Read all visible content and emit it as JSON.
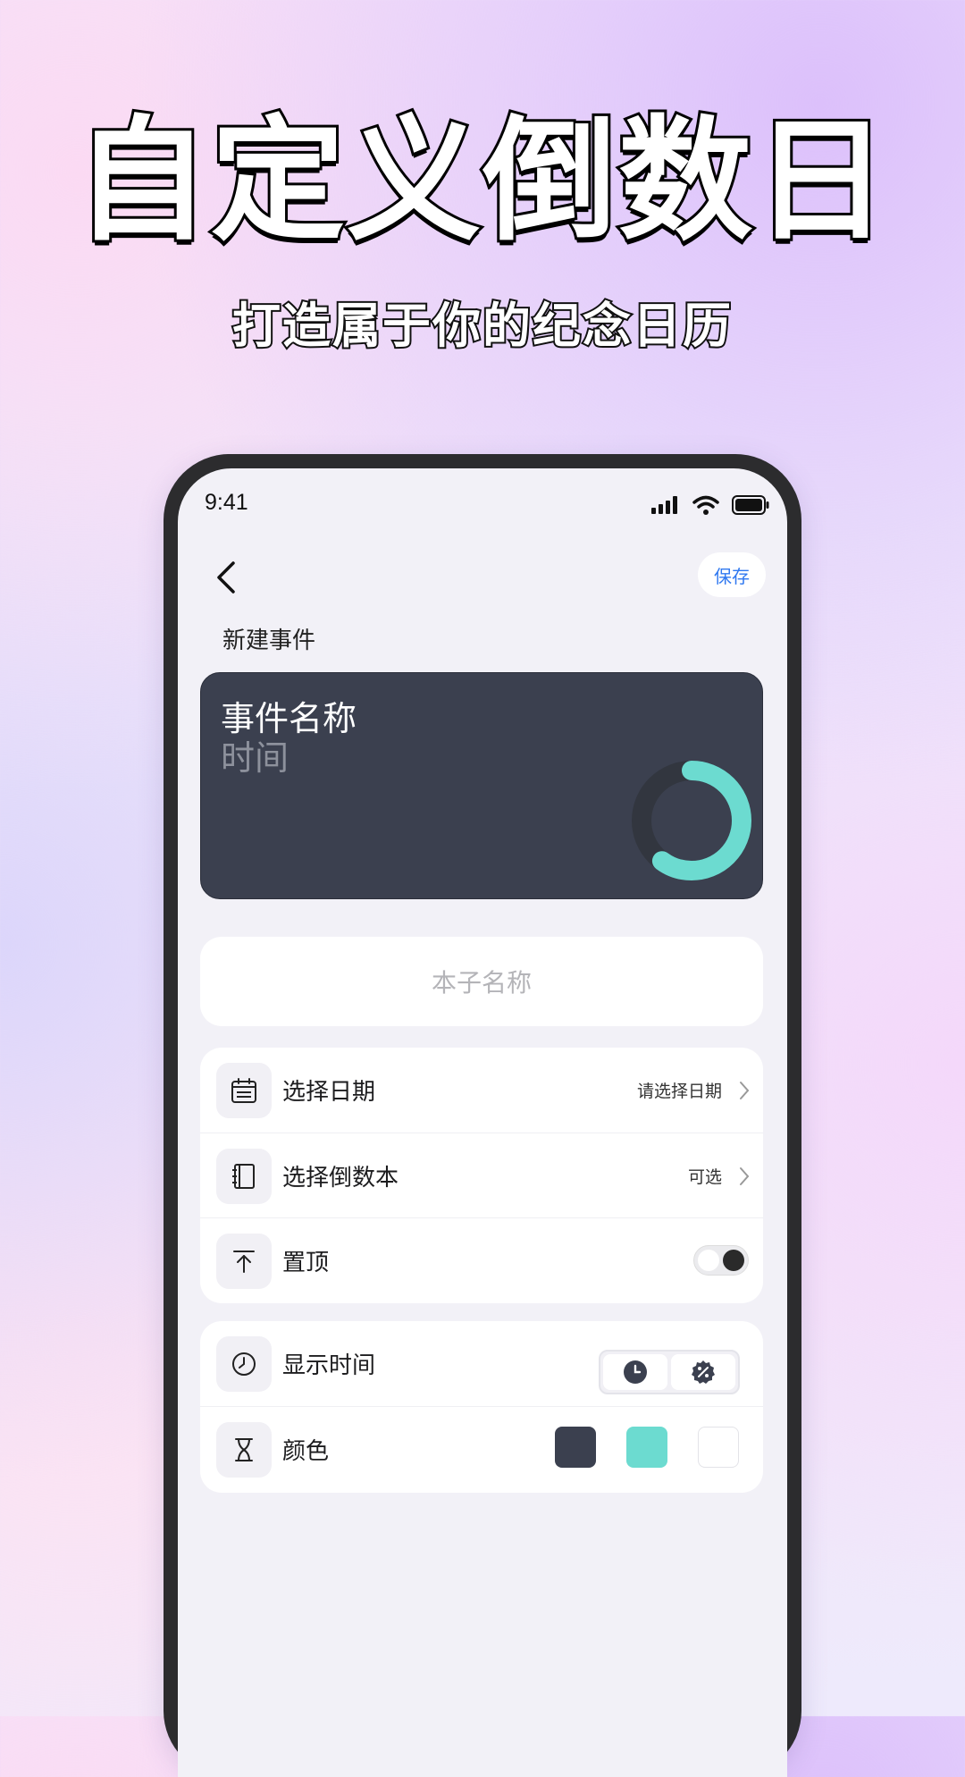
{
  "promo": {
    "headline": "自定义倒数日",
    "subheadline": "打造属于你的纪念日历"
  },
  "status_bar": {
    "time": "9:41"
  },
  "nav": {
    "save_label": "保存",
    "title": "新建事件"
  },
  "preview": {
    "event_name": "事件名称",
    "time_label": "时间",
    "ring_progress": 0.6,
    "colors": {
      "card": "#3b404f",
      "ring": "#6cdbd0"
    }
  },
  "notebook_field": {
    "placeholder": "本子名称"
  },
  "settings": {
    "date": {
      "label": "选择日期",
      "value": "请选择日期"
    },
    "notebook": {
      "label": "选择倒数本",
      "value": "可选"
    },
    "pin": {
      "label": "置顶"
    },
    "display_time": {
      "label": "显示时间"
    },
    "color": {
      "label": "颜色",
      "options": [
        "#3b404f",
        "#6cdbd0",
        "#ffffff"
      ]
    }
  }
}
